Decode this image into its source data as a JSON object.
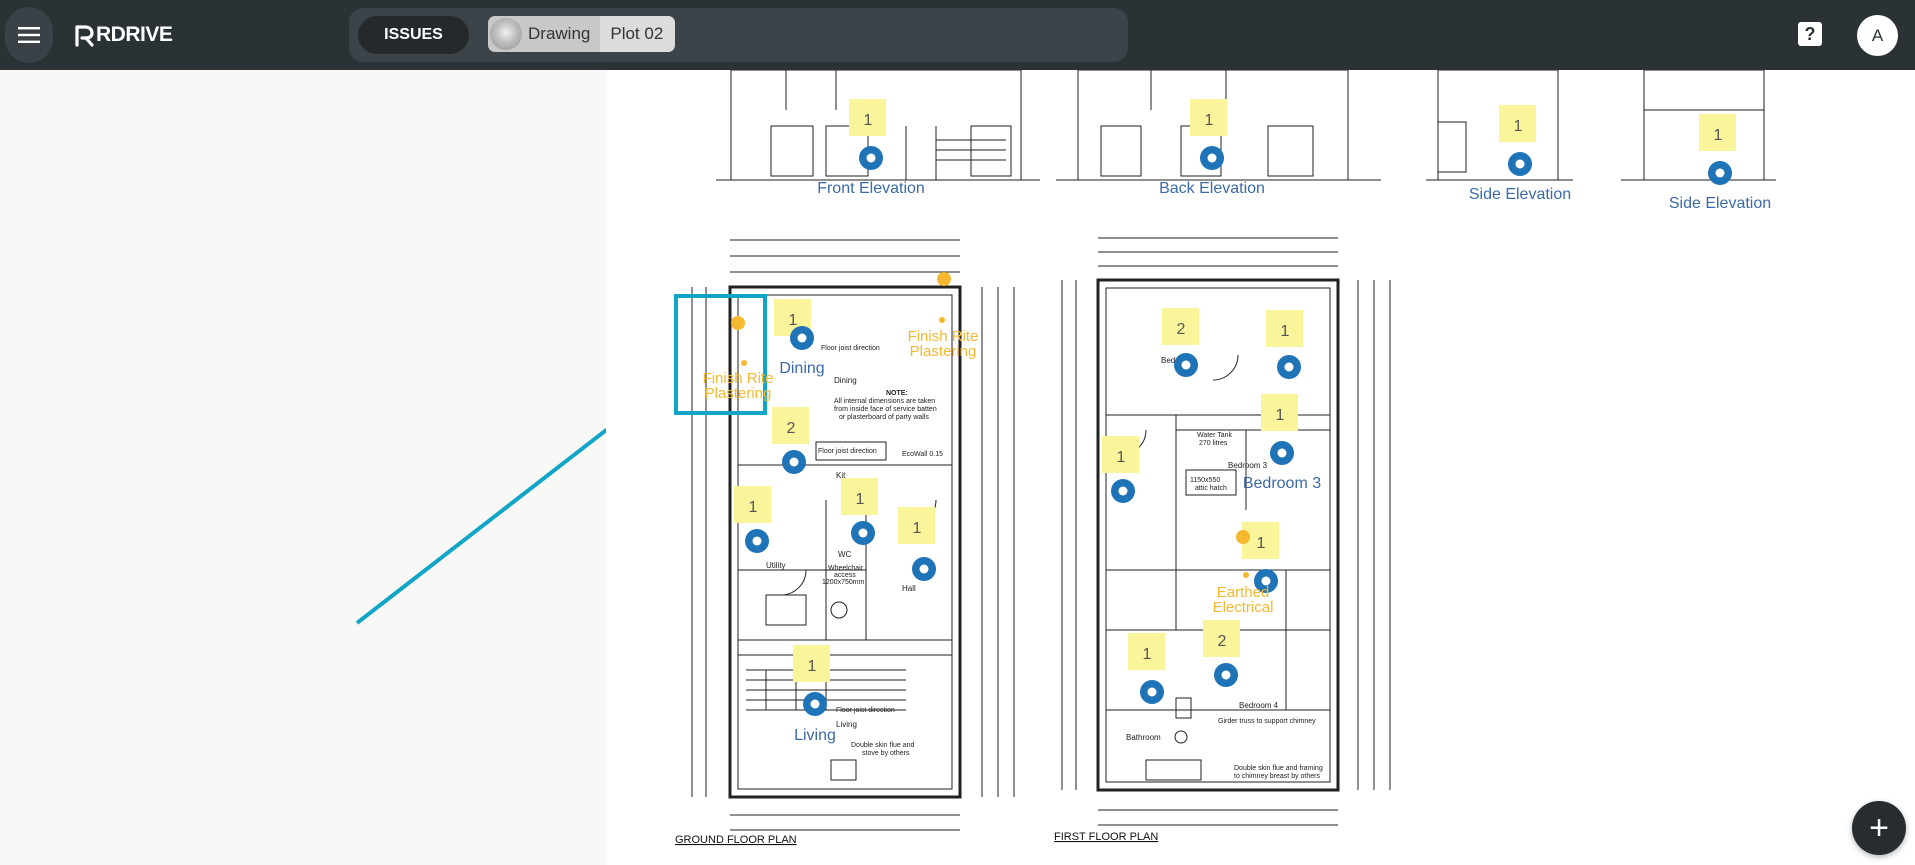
{
  "app": {
    "brand": "RDRIVE",
    "issues_label": "ISSUES",
    "breadcrumb": [
      "Drawing",
      "Plot 02"
    ],
    "help_label": "?",
    "account_initial": "A",
    "add_label": "+"
  },
  "drawing": {
    "elevation_labels": [
      "Front Elevation",
      "Back Elevation",
      "Side Elevation",
      "Side Elevation"
    ],
    "room_labels": [
      "Dining",
      "Living",
      "Bedroom 3"
    ],
    "issue_labels": [
      "Finish Rite Plastering",
      "Finish Rite Plastering",
      "Earthed Electrical"
    ],
    "sticky_counts": [
      "1",
      "1",
      "1",
      "1",
      "2",
      "1",
      "1",
      "1",
      "1",
      "2",
      "1",
      "1",
      "1",
      "1",
      "2",
      "1"
    ],
    "plan_titles": [
      "GROUND FLOOR PLAN",
      "FIRST FLOOR PLAN"
    ],
    "plan_notes": [
      "Dining",
      "Floor joist direction",
      "NOTE:",
      "All internal dimensions are taken",
      "from inside face of service batten",
      "or plasterboard of party walls",
      "Floor joist direction",
      "EcoWall 0.15",
      "Kit",
      "WC",
      "Wheelchair",
      "access",
      "1200x750mm",
      "Hall",
      "Utility",
      "Living",
      "Floor joist direction",
      "Double skin flue and",
      "stove by others",
      "Bed",
      "Water Tank",
      "270 litres",
      "Bedroom 3",
      "1150x550",
      "attic hatch",
      "Bedroom 4",
      "Bathroom",
      "Girder truss to support chimney",
      "Double skin flue and framing",
      "to chimney breast by others"
    ],
    "colors": {
      "issue_pin": "#1f73b7",
      "sticky": "#faf59b",
      "issue_text": "#f5b82e",
      "selection": "#11a5c7"
    }
  }
}
